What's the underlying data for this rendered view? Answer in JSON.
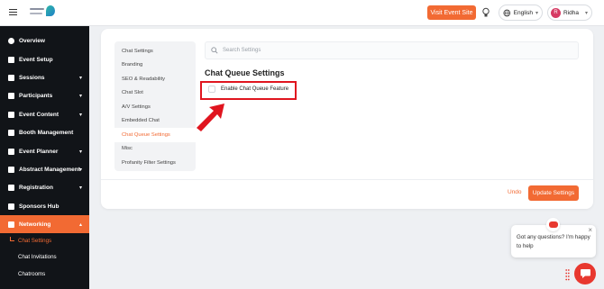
{
  "topbar": {
    "visit_button": "Visit Event Site",
    "language": "English",
    "user_name": "Ridha",
    "user_initial": "R"
  },
  "sidebar": {
    "items": [
      {
        "label": "Overview",
        "icon": "overview-icon",
        "caret": false,
        "active": false
      },
      {
        "label": "Event Setup",
        "icon": "calendar-icon",
        "caret": false,
        "active": false
      },
      {
        "label": "Sessions",
        "icon": "grid-icon",
        "caret": true,
        "active": false
      },
      {
        "label": "Participants",
        "icon": "users-icon",
        "caret": true,
        "active": false
      },
      {
        "label": "Event Content",
        "icon": "document-icon",
        "caret": true,
        "active": false
      },
      {
        "label": "Booth Management",
        "icon": "booth-icon",
        "caret": false,
        "active": false
      },
      {
        "label": "Event Planner",
        "icon": "planner-icon",
        "caret": true,
        "active": false
      },
      {
        "label": "Abstract Management",
        "icon": "abstract-icon",
        "caret": true,
        "active": false
      },
      {
        "label": "Registration",
        "icon": "registration-icon",
        "caret": true,
        "active": false
      },
      {
        "label": "Sponsors Hub",
        "icon": "sponsors-icon",
        "caret": false,
        "active": false
      },
      {
        "label": "Networking",
        "icon": "share-icon",
        "caret": true,
        "active": true
      }
    ],
    "sub_items": [
      {
        "label": "Chat Settings",
        "active": true
      },
      {
        "label": "Chat Invitations",
        "active": false
      },
      {
        "label": "Chatrooms",
        "active": false
      }
    ]
  },
  "settings_nav": [
    {
      "label": "Chat Settings",
      "active": false
    },
    {
      "label": "Branding",
      "active": false
    },
    {
      "label": "SEO & Readability",
      "active": false
    },
    {
      "label": "Chat Slot",
      "active": false
    },
    {
      "label": "A/V Settings",
      "active": false
    },
    {
      "label": "Embedded Chat",
      "active": false
    },
    {
      "label": "Chat Queue Settings",
      "active": true
    },
    {
      "label": "Misc",
      "active": false
    },
    {
      "label": "Profanity Filter Settings",
      "active": false
    }
  ],
  "search": {
    "placeholder": "Search Settings"
  },
  "section": {
    "title": "Chat Queue Settings",
    "checkbox_label": "Enable Chat Queue Feature",
    "checkbox_checked": false
  },
  "actions": {
    "undo": "Undo",
    "update": "Update Settings"
  },
  "chat_widget": {
    "message": "Got any questions? I'm happy to help"
  },
  "colors": {
    "accent": "#f26a33",
    "sidebar_bg": "#111418",
    "highlight": "#e0151f",
    "chat_red": "#e8382f"
  }
}
